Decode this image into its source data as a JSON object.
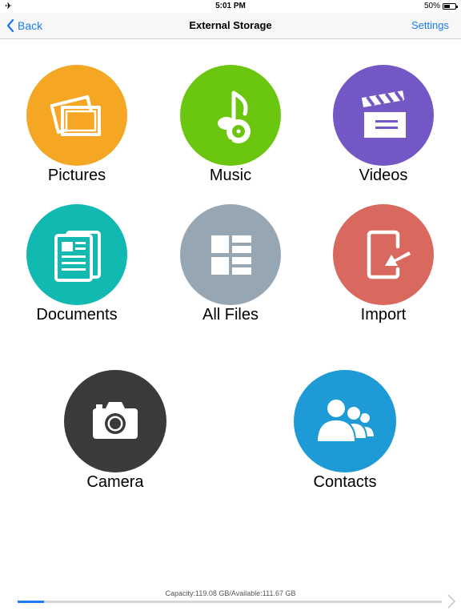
{
  "status_bar": {
    "time": "5:01 PM",
    "battery_text": "50%",
    "battery_level": 0.5,
    "airplane_icon": "airplane-icon"
  },
  "nav": {
    "back_label": "Back",
    "title": "External Storage",
    "settings_label": "Settings"
  },
  "tiles": [
    {
      "label": "Pictures",
      "color": "#f5a623",
      "icon": "pictures-icon"
    },
    {
      "label": "Music",
      "color": "#6ac60e",
      "icon": "music-icon"
    },
    {
      "label": "Videos",
      "color": "#7358c5",
      "icon": "videos-icon"
    },
    {
      "label": "Documents",
      "color": "#11b9b0",
      "icon": "documents-icon"
    },
    {
      "label": "All Files",
      "color": "#97a6b3",
      "icon": "all-files-icon"
    },
    {
      "label": "Import",
      "color": "#d9685e",
      "icon": "import-icon"
    },
    {
      "label": "Camera",
      "color": "#3a3a3a",
      "icon": "camera-icon"
    },
    {
      "label": "Contacts",
      "color": "#1e9ad6",
      "icon": "contacts-icon"
    }
  ],
  "storage": {
    "capacity_text": "Capacity:119.08 GB/Available:111.67 GB",
    "used_fraction": 0.062
  },
  "accent_color": "#1a7cf0"
}
